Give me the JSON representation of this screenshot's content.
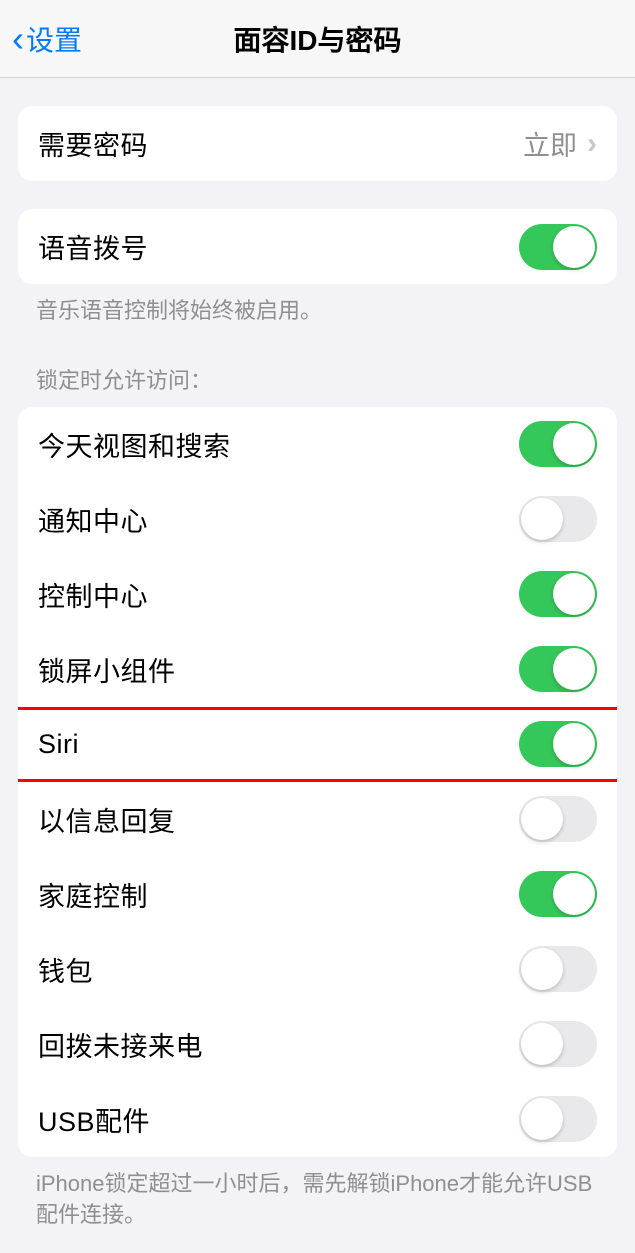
{
  "header": {
    "back_label": "设置",
    "title": "面容ID与密码"
  },
  "require_passcode": {
    "label": "需要密码",
    "value": "立即"
  },
  "voice_dial": {
    "label": "语音拨号",
    "on": true,
    "footer": "音乐语音控制将始终被启用。"
  },
  "lock_access": {
    "header": "锁定时允许访问：",
    "items": [
      {
        "label": "今天视图和搜索",
        "on": true
      },
      {
        "label": "通知中心",
        "on": false
      },
      {
        "label": "控制中心",
        "on": true
      },
      {
        "label": "锁屏小组件",
        "on": true
      },
      {
        "label": "Siri",
        "on": true
      },
      {
        "label": "以信息回复",
        "on": false
      },
      {
        "label": "家庭控制",
        "on": true
      },
      {
        "label": "钱包",
        "on": false
      },
      {
        "label": "回拨未接来电",
        "on": false
      },
      {
        "label": "USB配件",
        "on": false
      }
    ],
    "footer": "iPhone锁定超过一小时后，需先解锁iPhone才能允许USB配件连接。"
  }
}
